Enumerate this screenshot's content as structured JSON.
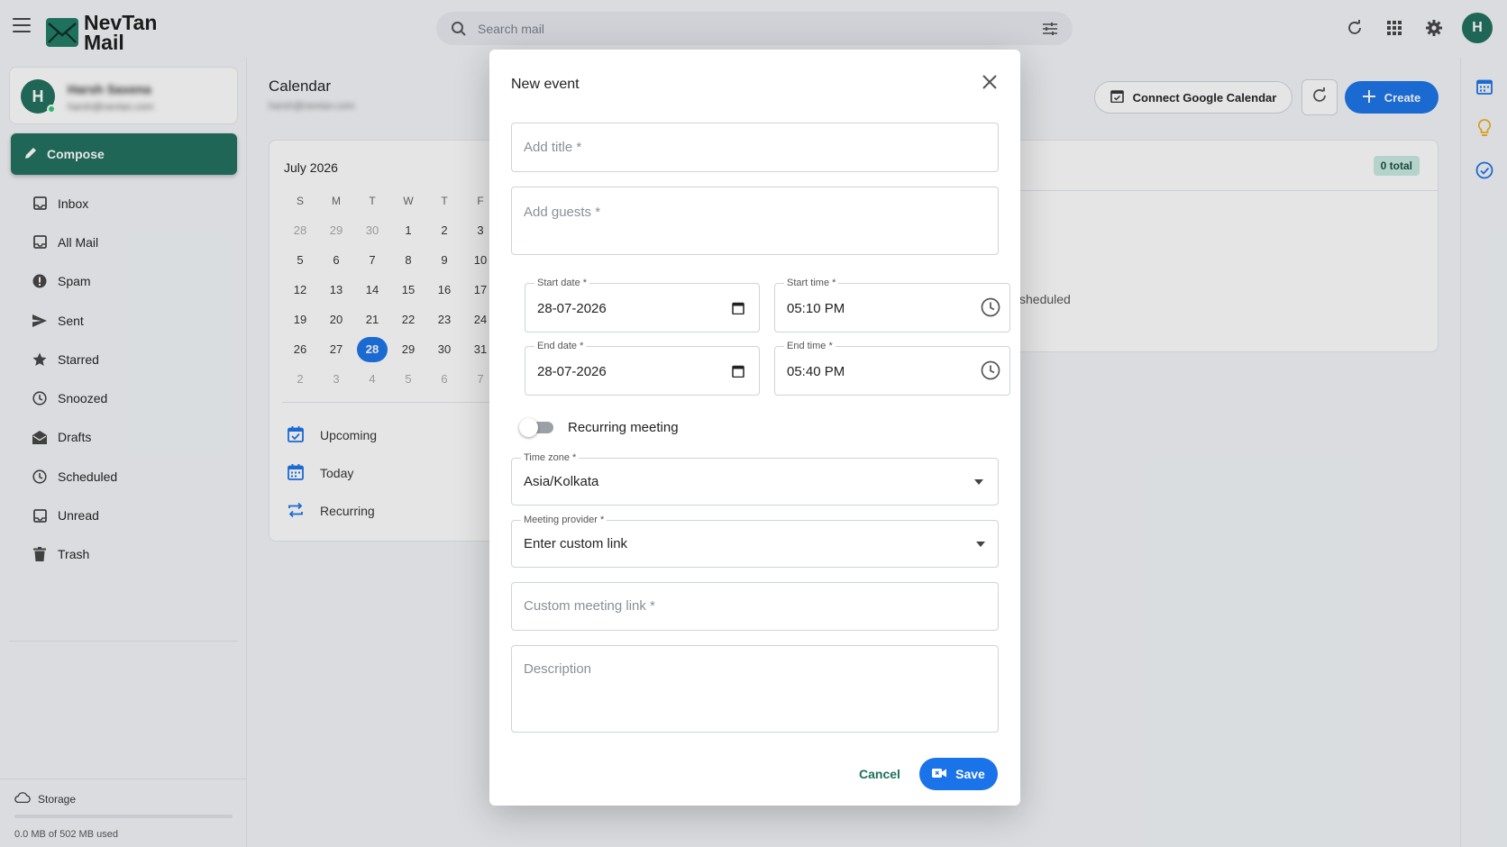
{
  "app": {
    "brand_line1": "NevTan",
    "brand_line2": "Mail",
    "search_placeholder": "Search mail",
    "avatar_initial": "H",
    "accent": "#1e6f5c",
    "primary": "#1a73e8"
  },
  "profile": {
    "initial": "H",
    "name": "Harsh Saxena",
    "email": "harsh@nevtan.com"
  },
  "sidebar": {
    "compose_label": "Compose",
    "items": [
      {
        "label": "Inbox",
        "icon": "inbox-icon"
      },
      {
        "label": "All Mail",
        "icon": "all-mail-icon"
      },
      {
        "label": "Spam",
        "icon": "spam-icon"
      },
      {
        "label": "Sent",
        "icon": "sent-icon"
      },
      {
        "label": "Starred",
        "icon": "star-icon"
      },
      {
        "label": "Snoozed",
        "icon": "clock-icon"
      },
      {
        "label": "Drafts",
        "icon": "drafts-icon"
      },
      {
        "label": "Scheduled",
        "icon": "clock-icon"
      },
      {
        "label": "Unread",
        "icon": "unread-icon"
      },
      {
        "label": "Trash",
        "icon": "trash-icon"
      }
    ],
    "storage_label": "Storage",
    "storage_used": "0.0 MB of 502 MB used",
    "storage_fraction": 0.0
  },
  "calendar": {
    "title": "Calendar",
    "subtitle": "harsh@nevtan.com",
    "month_label": "July 2026",
    "weekdays": [
      "S",
      "M",
      "T",
      "W",
      "T",
      "F"
    ],
    "weeks": [
      [
        "28",
        "29",
        "30",
        "1",
        "2",
        "3"
      ],
      [
        "5",
        "6",
        "7",
        "8",
        "9",
        "10"
      ],
      [
        "12",
        "13",
        "14",
        "15",
        "16",
        "17"
      ],
      [
        "19",
        "20",
        "21",
        "22",
        "23",
        "24"
      ],
      [
        "26",
        "27",
        "28",
        "29",
        "30",
        "31"
      ],
      [
        "2",
        "3",
        "4",
        "5",
        "6",
        "7"
      ]
    ],
    "selected_day": "28",
    "links": [
      {
        "label": "Upcoming",
        "icon": "calendar-check-icon"
      },
      {
        "label": "Today",
        "icon": "calendar-today-icon"
      },
      {
        "label": "Recurring",
        "icon": "repeat-icon"
      }
    ],
    "connect_label": "Connect Google Calendar",
    "create_label": "Create",
    "total_badge": "0 total",
    "empty_text": "sheduled"
  },
  "modal": {
    "title": "New event",
    "title_placeholder": "Add title *",
    "guests_placeholder": "Add guests *",
    "start_date_label": "Start date *",
    "start_date_value": "28-07-2026",
    "start_time_label": "Start time *",
    "start_time_value": "05:10 PM",
    "end_date_label": "End date *",
    "end_date_value": "28-07-2026",
    "end_time_label": "End time *",
    "end_time_value": "05:40 PM",
    "recurring_label": "Recurring meeting",
    "recurring_on": false,
    "timezone_label": "Time zone *",
    "timezone_value": "Asia/Kolkata",
    "provider_label": "Meeting provider *",
    "provider_value": "Enter custom link",
    "custom_link_placeholder": "Custom meeting link *",
    "description_placeholder": "Description",
    "cancel_label": "Cancel",
    "save_label": "Save"
  }
}
